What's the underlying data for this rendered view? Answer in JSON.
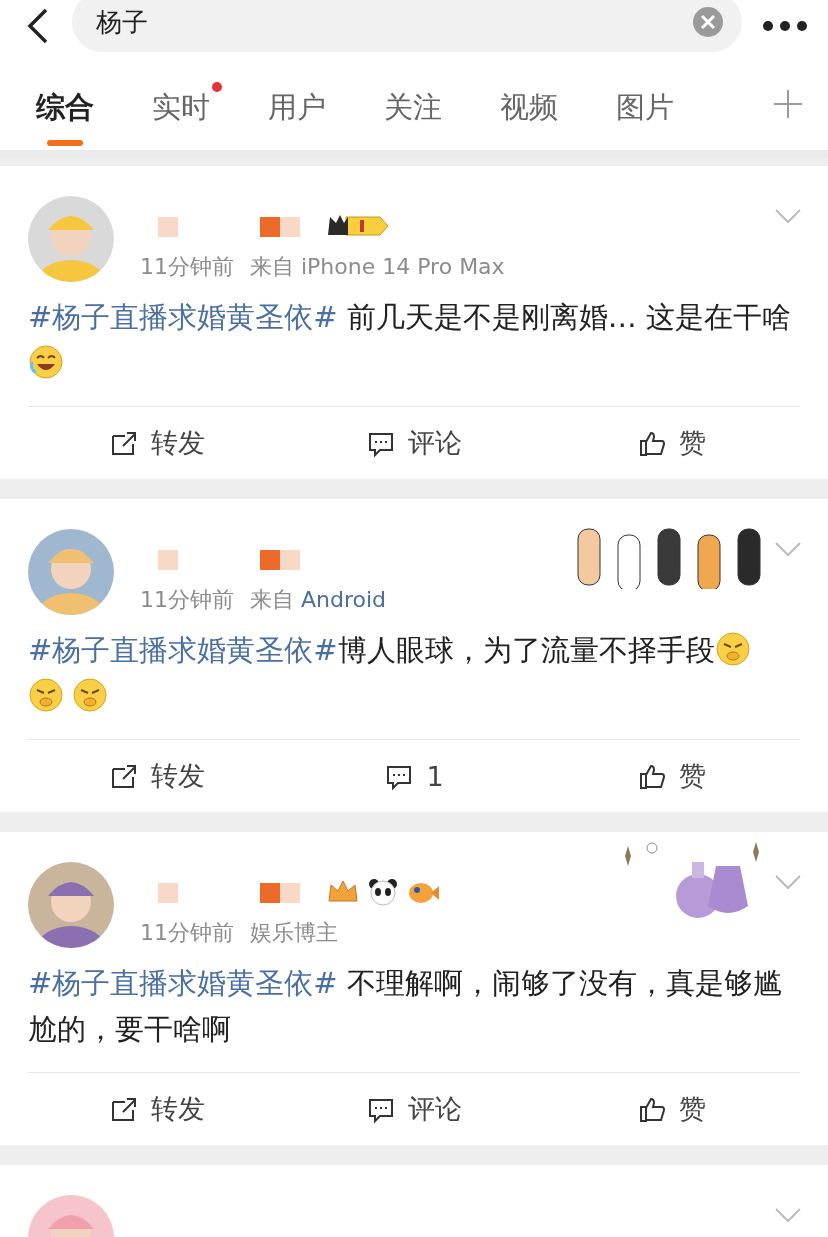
{
  "search": {
    "value": "杨子"
  },
  "tabs": [
    {
      "label": "综合",
      "selected": true,
      "dot": false
    },
    {
      "label": "实时",
      "selected": false,
      "dot": true
    },
    {
      "label": "用户",
      "selected": false,
      "dot": false
    },
    {
      "label": "关注",
      "selected": false,
      "dot": false
    },
    {
      "label": "视频",
      "selected": false,
      "dot": false
    },
    {
      "label": "图片",
      "selected": false,
      "dot": false
    }
  ],
  "posts": [
    {
      "kind": "full",
      "badges": [
        {
          "kind": "crown-level"
        }
      ],
      "time": "11分钟前",
      "source": "来自 iPhone 14 Pro Max",
      "hashtag": "#杨子直播求婚黄圣依#",
      "text": " 前几天是不是刚离婚… 这是在干啥",
      "emojis": [
        {
          "kind": "laugh"
        }
      ],
      "actions": [
        "转发",
        "评论",
        "赞"
      ]
    },
    {
      "kind": "full",
      "time": "11分钟前",
      "source": "来自",
      "source_link": "Android",
      "decoration": {
        "kind": "paws"
      },
      "hashtag": "#杨子直播求婚黄圣依#",
      "text": "博人眼球，为了流量不择手段",
      "emojis": [
        {
          "kind": "huff"
        },
        {
          "kind": "huff"
        },
        {
          "kind": "huff"
        }
      ],
      "actions": [
        "转发",
        "1",
        "赞"
      ]
    },
    {
      "kind": "full",
      "badges": [
        {
          "kind": "crown"
        },
        {
          "kind": "panda"
        },
        {
          "kind": "fish"
        }
      ],
      "time": "11分钟前",
      "source": "娱乐博主",
      "decoration": {
        "kind": "potions"
      },
      "hashtag": "#杨子直播求婚黄圣依#",
      "text": " 不理解啊，闹够了没有，真是够尴尬的，要干啥啊",
      "actions": [
        "转发",
        "评论",
        "赞"
      ]
    },
    {
      "kind": "partial"
    }
  ]
}
